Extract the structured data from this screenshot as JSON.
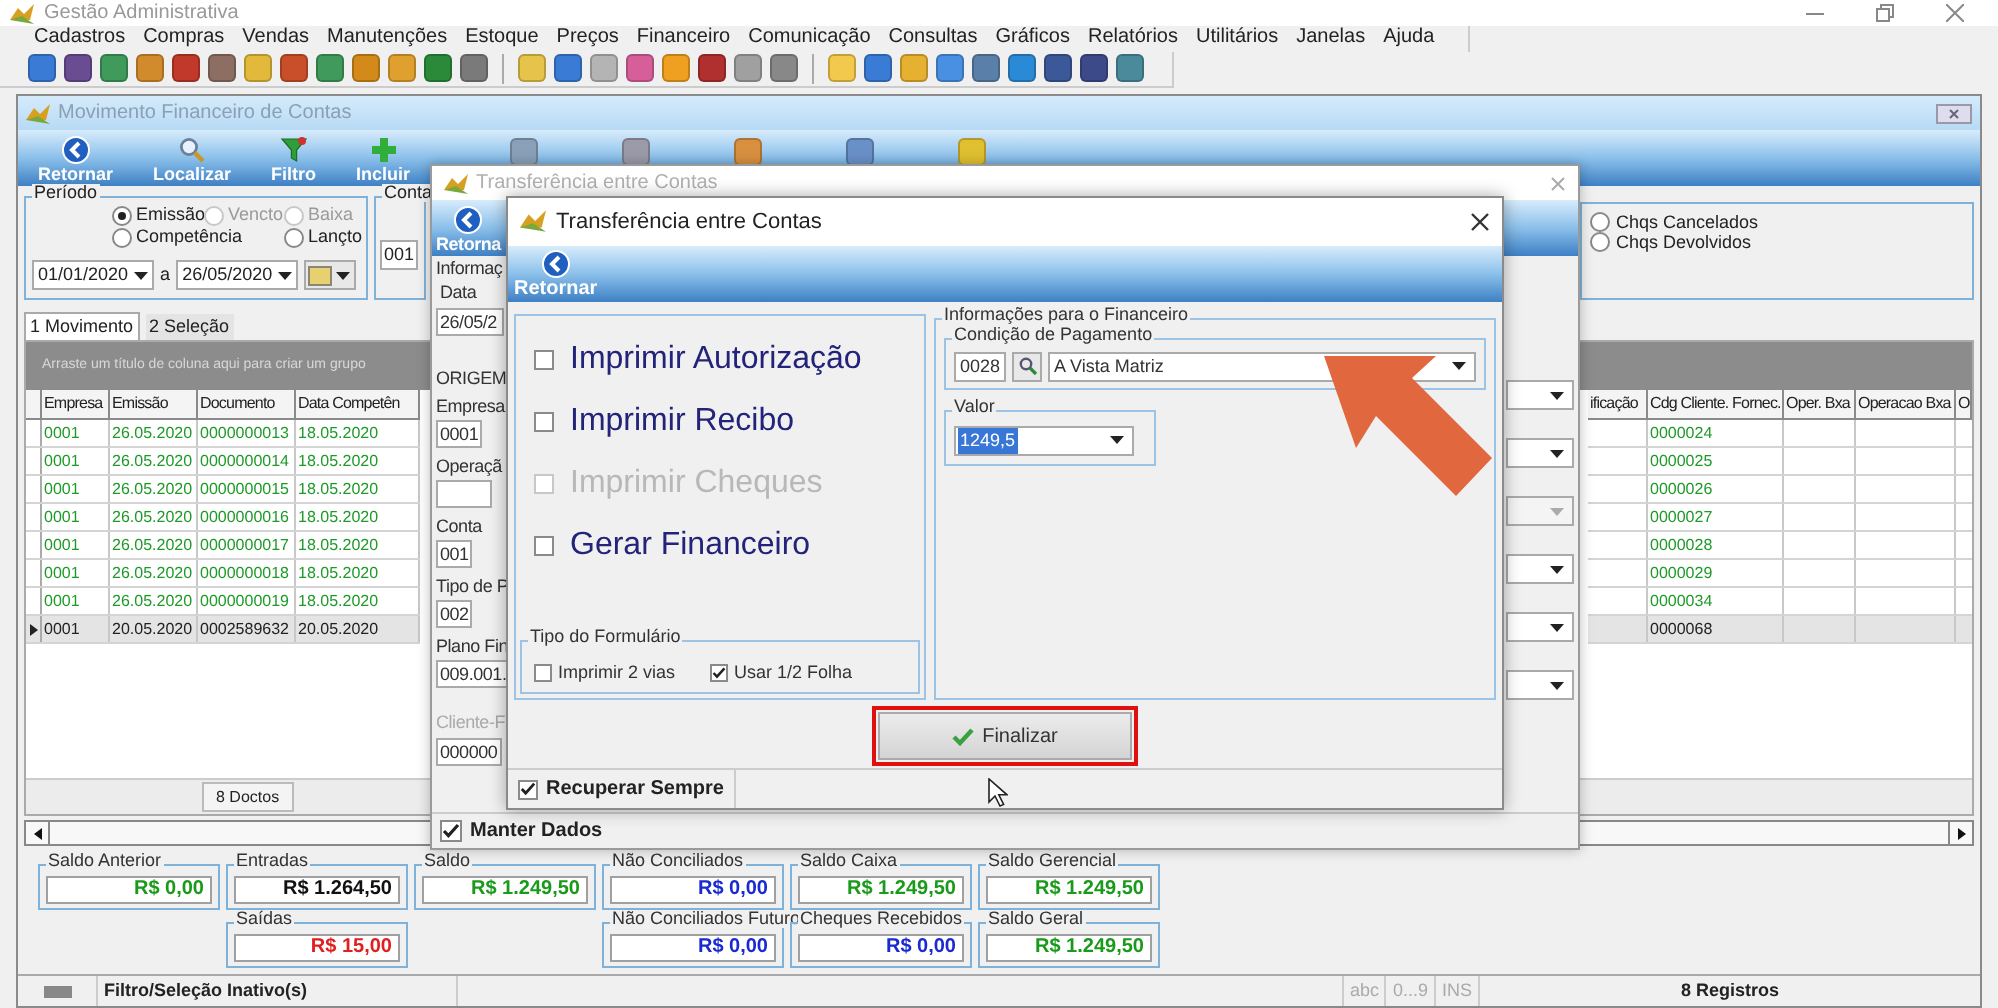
{
  "app": {
    "title": "Gestão Administrativa"
  },
  "menu": [
    "Cadastros",
    "Compras",
    "Vendas",
    "Manutenções",
    "Estoque",
    "Preços",
    "Financeiro",
    "Comunicação",
    "Consultas",
    "Gráficos",
    "Relatórios",
    "Utilitários",
    "Janelas",
    "Ajuda"
  ],
  "child_window": {
    "title": "Movimento Financeiro de Contas",
    "toolbar": [
      {
        "label": "Retornar",
        "kind": "back"
      },
      {
        "label": "Localizar",
        "kind": "search"
      },
      {
        "label": "Filtro",
        "kind": "filter"
      },
      {
        "label": "Incluir",
        "kind": "add"
      }
    ],
    "period": {
      "label": "Período",
      "options": [
        {
          "label": "Emissão",
          "selected": true,
          "disabled": false
        },
        {
          "label": "Vencto",
          "selected": false,
          "disabled": true
        },
        {
          "label": "Baixa",
          "selected": false,
          "disabled": true
        },
        {
          "label": "Competência",
          "selected": false,
          "disabled": false
        },
        {
          "label": "Lançto",
          "selected": false,
          "disabled": false
        }
      ],
      "date_from": "01/01/2020",
      "separator": "a",
      "date_to": "26/05/2020"
    },
    "account": {
      "label": "Conta",
      "value": "001"
    },
    "cheques": [
      {
        "label": "Chqs Cancelados",
        "selected": false
      },
      {
        "label": "Chqs Devolvidos",
        "selected": false
      }
    ],
    "tabs": [
      {
        "label": "1 Movimento",
        "selected": true
      },
      {
        "label": "2 Seleção",
        "selected": false
      }
    ],
    "grid": {
      "group_hint": "Arraste um título de coluna aqui para criar um grupo",
      "columns_left": [
        "Empresa",
        "Emissão",
        "Documento",
        "Data Competên"
      ],
      "columns_right": [
        "ificação",
        "Cdg Cliente. Fornec.",
        "Oper. Bxa",
        "Operacao Bxa",
        "O"
      ],
      "rows": [
        {
          "selected": false,
          "empresa": "0001",
          "emissao": "26.05.2020",
          "documento": "0000000013",
          "competencia": "18.05.2020",
          "cliente": "0000024"
        },
        {
          "selected": false,
          "empresa": "0001",
          "emissao": "26.05.2020",
          "documento": "0000000014",
          "competencia": "18.05.2020",
          "cliente": "0000025"
        },
        {
          "selected": false,
          "empresa": "0001",
          "emissao": "26.05.2020",
          "documento": "0000000015",
          "competencia": "18.05.2020",
          "cliente": "0000026"
        },
        {
          "selected": false,
          "empresa": "0001",
          "emissao": "26.05.2020",
          "documento": "0000000016",
          "competencia": "18.05.2020",
          "cliente": "0000027"
        },
        {
          "selected": false,
          "empresa": "0001",
          "emissao": "26.05.2020",
          "documento": "0000000017",
          "competencia": "18.05.2020",
          "cliente": "0000028"
        },
        {
          "selected": false,
          "empresa": "0001",
          "emissao": "26.05.2020",
          "documento": "0000000018",
          "competencia": "18.05.2020",
          "cliente": "0000029"
        },
        {
          "selected": false,
          "empresa": "0001",
          "emissao": "26.05.2020",
          "documento": "0000000019",
          "competencia": "18.05.2020",
          "cliente": "0000034"
        },
        {
          "selected": true,
          "empresa": "0001",
          "emissao": "20.05.2020",
          "documento": "0002589632",
          "competencia": "20.05.2020",
          "cliente": "0000068"
        }
      ],
      "footer": "8 Doctos"
    },
    "totals": [
      {
        "items": [
          {
            "label": "Saldo Anterior",
            "value": "R$ 0,00",
            "color": "#1a9a1a"
          }
        ]
      },
      {
        "items": [
          {
            "label": "Entradas",
            "value": "R$ 1.264,50",
            "color": "#111111"
          },
          {
            "label": "Saídas",
            "value": "R$ 15,00",
            "color": "#e02020"
          }
        ]
      },
      {
        "items": [
          {
            "label": "Saldo",
            "value": "R$ 1.249,50",
            "color": "#1a9a1a"
          }
        ]
      },
      {
        "items": [
          {
            "label": "Não Conciliados",
            "value": "R$ 0,00",
            "color": "#1a2ad0"
          },
          {
            "label": "Não Conciliados Futuro",
            "value": "R$ 0,00",
            "color": "#1a2ad0"
          }
        ]
      },
      {
        "items": [
          {
            "label": "Saldo Caixa",
            "value": "R$ 1.249,50",
            "color": "#1a9a1a"
          },
          {
            "label": "Cheques Recebidos",
            "value": "R$ 0,00",
            "color": "#1a2ad0"
          }
        ]
      },
      {
        "items": [
          {
            "label": "Saldo Gerencial",
            "value": "R$ 1.249,50",
            "color": "#1a9a1a"
          },
          {
            "label": "Saldo Geral",
            "value": "R$ 1.249,50",
            "color": "#1a9a1a"
          }
        ]
      }
    ],
    "status_bar": {
      "filter": "Filtro/Seleção Inativo(s)",
      "indicators": [
        "abc",
        "0...9",
        "INS"
      ],
      "records": "8 Registros"
    }
  },
  "dialog_back": {
    "title": "Transferência entre Contas",
    "toolbar_label": "Retorna",
    "info_label": "Informaç",
    "date_label": "Data",
    "date_value": "26/05/2",
    "origin_label": "ORIGEM",
    "fields": [
      {
        "label": "Empresa",
        "value": "0001"
      },
      {
        "label": "Operaçã"
      },
      {
        "label": "Conta",
        "value": "001"
      },
      {
        "label": "Tipo de P",
        "value": "002"
      },
      {
        "label": "Plano Fin",
        "value": "009.001."
      }
    ],
    "client": {
      "label": "Cliente-F",
      "value": "000000"
    },
    "dropdowns": [
      {
        "disabled": false
      },
      {
        "disabled": false
      },
      {
        "disabled": true
      },
      {
        "disabled": false
      },
      {
        "disabled": false
      },
      {
        "disabled": false
      }
    ],
    "keep_data": {
      "label": "Manter Dados",
      "checked": true
    }
  },
  "dialog_front": {
    "title": "Transferência entre Contas",
    "toolbar_label": "Retornar",
    "options": [
      {
        "label": "Imprimir Autorização",
        "checked": false,
        "disabled": false
      },
      {
        "label": "Imprimir Recibo",
        "checked": false,
        "disabled": false
      },
      {
        "label": "Imprimir Cheques",
        "checked": false,
        "disabled": true
      },
      {
        "label": "Gerar Financeiro",
        "checked": false,
        "disabled": false
      }
    ],
    "form_type": {
      "label": "Tipo do Formulário",
      "options": [
        {
          "label": "Imprimir 2 vias",
          "checked": false
        },
        {
          "label": "Usar 1/2 Folha",
          "checked": true
        }
      ]
    },
    "finance": {
      "label": "Informações para o Financeiro",
      "payment": {
        "label": "Condição de Pagamento",
        "code": "0028",
        "value": "A Vista Matriz"
      },
      "amount": {
        "label": "Valor",
        "value": "1249,5"
      }
    },
    "finish_button": "Finalizar",
    "keep_checkbox": {
      "label": "Recuperar Sempre",
      "checked": true
    }
  }
}
